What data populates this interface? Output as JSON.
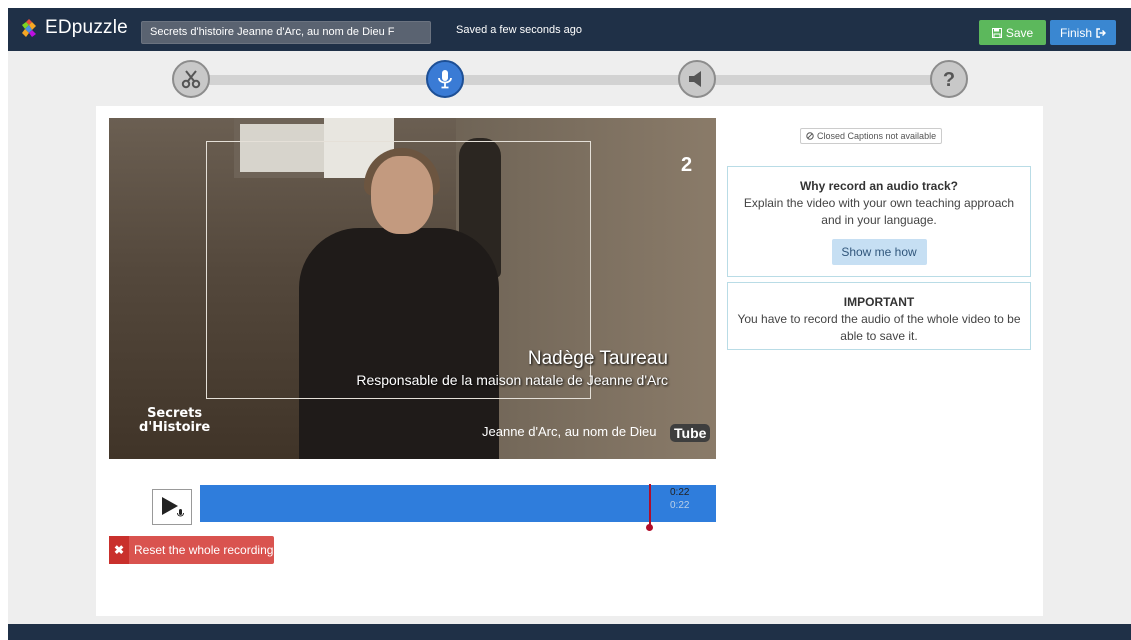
{
  "app": {
    "logo_text": "EDpuzzle",
    "video_title_field": "Secrets d'histoire  Jeanne d'Arc, au nom de Dieu F",
    "saved_status": "Saved a few seconds ago",
    "save_label": "Save",
    "finish_label": "Finish"
  },
  "steps": [
    {
      "name": "cut",
      "icon": "scissors-icon",
      "active": false
    },
    {
      "name": "voiceover",
      "icon": "microphone-icon",
      "active": true
    },
    {
      "name": "audio-notes",
      "icon": "speaker-icon",
      "active": false
    },
    {
      "name": "quiz",
      "icon": "question-icon",
      "active": false
    }
  ],
  "video": {
    "speaker_name": "Nadège Taureau",
    "speaker_role": "Responsable de la maison natale de Jeanne d'Arc",
    "show_logo_line1": "Secrets",
    "show_logo_line2": "d'Histoire",
    "channel_logo": "2",
    "overlay_title": "Jeanne d'Arc, au nom de Dieu",
    "youtube_logo": "Tube"
  },
  "player": {
    "current_time": "0:22",
    "total_time": "0:22",
    "progress": 0.82
  },
  "actions": {
    "reset_label": "Reset the whole recording"
  },
  "sidebar": {
    "captions_badge": "Closed Captions not available",
    "why_title": "Why record an audio track?",
    "why_text": "Explain the video with your own teaching approach and in your language.",
    "show_me_how": "Show me how",
    "important_title": "IMPORTANT",
    "important_text": "You have to record the audio of the whole video to be able to save it."
  },
  "colors": {
    "topbar": "#1f3047",
    "save": "#5cb85c",
    "finish": "#3a87d1",
    "timeline": "#2f7ddc",
    "reset": "#d9534f",
    "active_step": "#3a7bd5"
  }
}
